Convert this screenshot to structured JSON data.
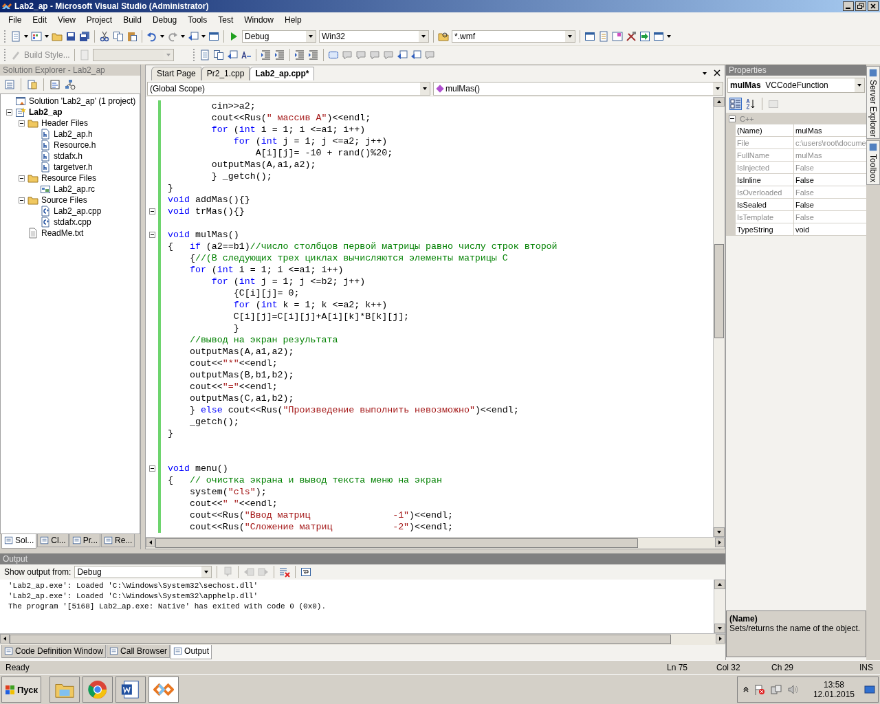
{
  "window": {
    "title": "Lab2_ap - Microsoft Visual Studio (Administrator)"
  },
  "menu": [
    "File",
    "Edit",
    "View",
    "Project",
    "Build",
    "Debug",
    "Tools",
    "Test",
    "Window",
    "Help"
  ],
  "toolbar": {
    "configuration": "Debug",
    "platform": "Win32",
    "find_filter": "*.wmf",
    "build_style": "Build Style..."
  },
  "solution_explorer": {
    "title": "Solution Explorer - Lab2_ap",
    "tree": [
      {
        "label": "Solution 'Lab2_ap' (1 project)",
        "kind": "solution",
        "children": [
          {
            "label": "Lab2_ap",
            "kind": "project",
            "expanded": true,
            "children": [
              {
                "label": "Header Files",
                "kind": "folder",
                "expanded": true,
                "children": [
                  {
                    "label": "Lab2_ap.h",
                    "kind": "header"
                  },
                  {
                    "label": "Resource.h",
                    "kind": "header"
                  },
                  {
                    "label": "stdafx.h",
                    "kind": "header"
                  },
                  {
                    "label": "targetver.h",
                    "kind": "header"
                  }
                ]
              },
              {
                "label": "Resource Files",
                "kind": "folder",
                "expanded": true,
                "children": [
                  {
                    "label": "Lab2_ap.rc",
                    "kind": "resource"
                  }
                ]
              },
              {
                "label": "Source Files",
                "kind": "folder",
                "expanded": true,
                "children": [
                  {
                    "label": "Lab2_ap.cpp",
                    "kind": "source"
                  },
                  {
                    "label": "stdafx.cpp",
                    "kind": "source"
                  }
                ]
              },
              {
                "label": "ReadMe.txt",
                "kind": "text"
              }
            ]
          }
        ]
      }
    ],
    "tabs": [
      {
        "label": "Sol...",
        "selected": true
      },
      {
        "label": "Cl...",
        "selected": false
      },
      {
        "label": "Pr...",
        "selected": false
      },
      {
        "label": "Re...",
        "selected": false
      }
    ]
  },
  "editor": {
    "tabs": [
      {
        "label": "Start Page",
        "selected": false
      },
      {
        "label": "Pr2_1.cpp",
        "selected": false
      },
      {
        "label": "Lab2_ap.cpp*",
        "selected": true
      }
    ],
    "scope": "(Global Scope)",
    "member": "mulMas()",
    "lines": [
      {
        "fold": false,
        "parts": [
          {
            "kind": "plain",
            "text": "        cin>>a2;"
          }
        ]
      },
      {
        "fold": false,
        "parts": [
          {
            "kind": "plain",
            "text": "        cout<<Rus("
          },
          {
            "kind": "string",
            "text": "\" массив A\""
          },
          {
            "kind": "plain",
            "text": ")<<endl;"
          }
        ]
      },
      {
        "fold": false,
        "parts": [
          {
            "kind": "keyword",
            "text": "        for"
          },
          {
            "kind": "plain",
            "text": " ("
          },
          {
            "kind": "keyword",
            "text": "int"
          },
          {
            "kind": "plain",
            "text": " i = 1; i <=a1; i++)"
          }
        ]
      },
      {
        "fold": false,
        "parts": [
          {
            "kind": "keyword",
            "text": "            for"
          },
          {
            "kind": "plain",
            "text": " ("
          },
          {
            "kind": "keyword",
            "text": "int"
          },
          {
            "kind": "plain",
            "text": " j = 1; j <=a2; j++)"
          }
        ]
      },
      {
        "fold": false,
        "parts": [
          {
            "kind": "plain",
            "text": "                A[i][j]= -10 + rand()%20;"
          }
        ]
      },
      {
        "fold": false,
        "parts": [
          {
            "kind": "plain",
            "text": "        outputMas(A,a1,a2);"
          }
        ]
      },
      {
        "fold": false,
        "parts": [
          {
            "kind": "plain",
            "text": "        } _getch();"
          }
        ]
      },
      {
        "fold": false,
        "parts": [
          {
            "kind": "plain",
            "text": "}"
          }
        ]
      },
      {
        "fold": false,
        "parts": [
          {
            "kind": "keyword",
            "text": "void"
          },
          {
            "kind": "plain",
            "text": " addMas(){}"
          }
        ]
      },
      {
        "fold": true,
        "parts": [
          {
            "kind": "keyword",
            "text": "void"
          },
          {
            "kind": "plain",
            "text": " trMas(){}"
          }
        ]
      },
      {
        "fold": false
      },
      {
        "fold": true,
        "parts": [
          {
            "kind": "keyword",
            "text": "void"
          },
          {
            "kind": "plain",
            "text": " mulMas()"
          }
        ]
      },
      {
        "fold": false,
        "parts": [
          {
            "kind": "plain",
            "text": "{   "
          },
          {
            "kind": "keyword",
            "text": "if"
          },
          {
            "kind": "plain",
            "text": " (a2==b1)"
          },
          {
            "kind": "comment",
            "text": "//число столбцов первой матрицы равно числу строк второй"
          }
        ]
      },
      {
        "fold": false,
        "parts": [
          {
            "kind": "plain",
            "text": "    {"
          },
          {
            "kind": "comment",
            "text": "//(В следующих трех циклах вычисляются элементы матрицы С"
          }
        ]
      },
      {
        "fold": false,
        "parts": [
          {
            "kind": "keyword",
            "text": "    for"
          },
          {
            "kind": "plain",
            "text": " ("
          },
          {
            "kind": "keyword",
            "text": "int"
          },
          {
            "kind": "plain",
            "text": " i = 1; i <=a1; i++)"
          }
        ]
      },
      {
        "fold": false,
        "parts": [
          {
            "kind": "keyword",
            "text": "        for"
          },
          {
            "kind": "plain",
            "text": " ("
          },
          {
            "kind": "keyword",
            "text": "int"
          },
          {
            "kind": "plain",
            "text": " j = 1; j <=b2; j++)"
          }
        ]
      },
      {
        "fold": false,
        "parts": [
          {
            "kind": "plain",
            "text": "            {C[i][j]= 0;"
          }
        ]
      },
      {
        "fold": false,
        "parts": [
          {
            "kind": "keyword",
            "text": "            for"
          },
          {
            "kind": "plain",
            "text": " ("
          },
          {
            "kind": "keyword",
            "text": "int"
          },
          {
            "kind": "plain",
            "text": " k = 1; k <=a2; k++)"
          }
        ]
      },
      {
        "fold": false,
        "parts": [
          {
            "kind": "plain",
            "text": "            C[i][j]=C[i][j]+A[i][k]*B[k][j];"
          }
        ]
      },
      {
        "fold": false,
        "parts": [
          {
            "kind": "plain",
            "text": "            }"
          }
        ]
      },
      {
        "fold": false,
        "parts": [
          {
            "kind": "comment",
            "text": "    //вывод на экран результата"
          }
        ]
      },
      {
        "fold": false,
        "parts": [
          {
            "kind": "plain",
            "text": "    outputMas(A,a1,a2);"
          }
        ]
      },
      {
        "fold": false,
        "parts": [
          {
            "kind": "plain",
            "text": "    cout<<"
          },
          {
            "kind": "string",
            "text": "\"*\""
          },
          {
            "kind": "plain",
            "text": "<<endl;"
          }
        ]
      },
      {
        "fold": false,
        "parts": [
          {
            "kind": "plain",
            "text": "    outputMas(B,b1,b2);"
          }
        ]
      },
      {
        "fold": false,
        "parts": [
          {
            "kind": "plain",
            "text": "    cout<<"
          },
          {
            "kind": "string",
            "text": "\"=\""
          },
          {
            "kind": "plain",
            "text": "<<endl;"
          }
        ]
      },
      {
        "fold": false,
        "parts": [
          {
            "kind": "plain",
            "text": "    outputMas(C,a1,b2);"
          }
        ]
      },
      {
        "fold": false,
        "parts": [
          {
            "kind": "plain",
            "text": "    } "
          },
          {
            "kind": "keyword",
            "text": "else"
          },
          {
            "kind": "plain",
            "text": " cout<<Rus("
          },
          {
            "kind": "string",
            "text": "\"Произведение выполнить невозможно\""
          },
          {
            "kind": "plain",
            "text": ")<<endl;"
          }
        ]
      },
      {
        "fold": false,
        "parts": [
          {
            "kind": "plain",
            "text": "    _getch();"
          }
        ]
      },
      {
        "fold": false,
        "parts": [
          {
            "kind": "plain",
            "text": "}"
          }
        ]
      },
      {
        "fold": false
      },
      {
        "fold": false
      },
      {
        "fold": true,
        "parts": [
          {
            "kind": "keyword",
            "text": "void"
          },
          {
            "kind": "plain",
            "text": " menu()"
          }
        ]
      },
      {
        "fold": false,
        "parts": [
          {
            "kind": "plain",
            "text": "{   "
          },
          {
            "kind": "comment",
            "text": "// очистка экрана и вывод текста меню на экран"
          }
        ]
      },
      {
        "fold": false,
        "parts": [
          {
            "kind": "plain",
            "text": "    system("
          },
          {
            "kind": "string",
            "text": "\"cls\""
          },
          {
            "kind": "plain",
            "text": ");"
          }
        ]
      },
      {
        "fold": false,
        "parts": [
          {
            "kind": "plain",
            "text": "    cout<<"
          },
          {
            "kind": "string",
            "text": "\" \""
          },
          {
            "kind": "plain",
            "text": "<<endl;"
          }
        ]
      },
      {
        "fold": false,
        "parts": [
          {
            "kind": "plain",
            "text": "    cout<<Rus("
          },
          {
            "kind": "string",
            "text": "\"Ввод матриц               -1\""
          },
          {
            "kind": "plain",
            "text": ")<<endl;"
          }
        ]
      },
      {
        "fold": false,
        "parts": [
          {
            "kind": "plain",
            "text": "    cout<<Rus("
          },
          {
            "kind": "string",
            "text": "\"Сложение матриц           -2\""
          },
          {
            "kind": "plain",
            "text": ")<<endl;"
          }
        ]
      }
    ]
  },
  "output": {
    "title": "Output",
    "source_label": "Show output from:",
    "source": "Debug",
    "lines": [
      "'Lab2_ap.exe': Loaded 'C:\\Windows\\System32\\sechost.dll'",
      "'Lab2_ap.exe': Loaded 'C:\\Windows\\System32\\apphelp.dll'",
      "The program '[5168] Lab2_ap.exe: Native' has exited with code 0 (0x0)."
    ]
  },
  "bottom_tabs": [
    {
      "label": "Code Definition Window",
      "selected": false
    },
    {
      "label": "Call Browser",
      "selected": false
    },
    {
      "label": "Output",
      "selected": true
    }
  ],
  "properties": {
    "title": "Properties",
    "object_name": "mulMas",
    "object_type": "VCCodeFunction",
    "category": {
      "label": "C++",
      "expanded": true
    },
    "rows": [
      {
        "name": "(Name)",
        "value": "mulMas",
        "disabled": false
      },
      {
        "name": "File",
        "value": "c:\\users\\root\\docume",
        "disabled": true
      },
      {
        "name": "FullName",
        "value": "mulMas",
        "disabled": true
      },
      {
        "name": "IsInjected",
        "value": "False",
        "disabled": true
      },
      {
        "name": "IsInline",
        "value": "False",
        "disabled": false
      },
      {
        "name": "IsOverloaded",
        "value": "False",
        "disabled": true
      },
      {
        "name": "IsSealed",
        "value": "False",
        "disabled": false
      },
      {
        "name": "IsTemplate",
        "value": "False",
        "disabled": true
      },
      {
        "name": "TypeString",
        "value": "void",
        "disabled": false
      }
    ],
    "description_title": "(Name)",
    "description": "Sets/returns the name of the object."
  },
  "side_tabs": [
    "Server Explorer",
    "Toolbox"
  ],
  "status_bar": {
    "message": "Ready",
    "line": "Ln 75",
    "column": "Col 32",
    "char": "Ch 29",
    "mode": "INS"
  },
  "taskbar": {
    "start": "Пуск",
    "apps": [
      {
        "kind": "explorer",
        "selected": false
      },
      {
        "kind": "browser",
        "selected": false
      },
      {
        "kind": "word",
        "selected": false
      },
      {
        "kind": "studio",
        "selected": true
      }
    ],
    "time": "13:58",
    "date": "12.01.2015"
  }
}
